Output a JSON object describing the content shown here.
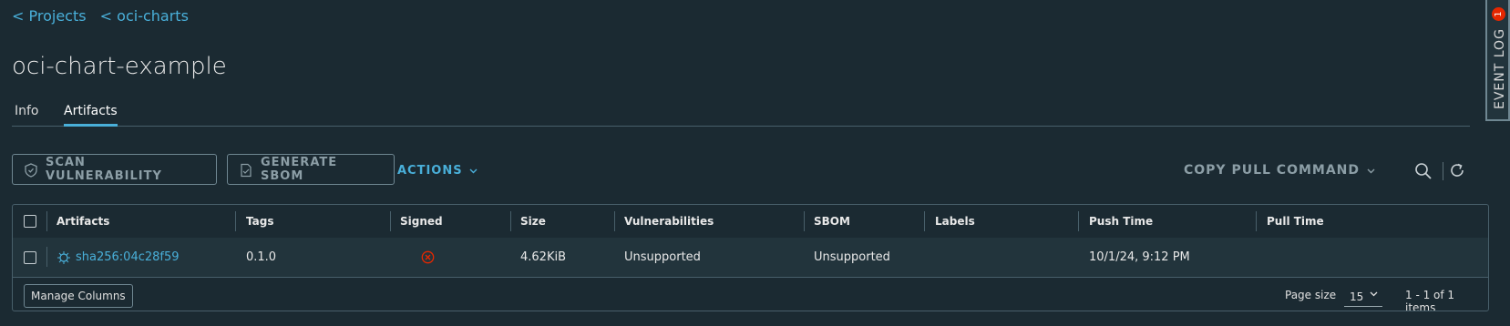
{
  "breadcrumb": {
    "projects": "< Projects",
    "repo": "< oci-charts"
  },
  "page_title": "oci-chart-example",
  "tabs": [
    {
      "label": "Info",
      "active": false
    },
    {
      "label": "Artifacts",
      "active": true
    }
  ],
  "toolbar": {
    "scan_label": "SCAN VULNERABILITY",
    "sbom_label": "GENERATE SBOM",
    "actions_label": "ACTIONS",
    "copy_pull_label": "COPY PULL COMMAND"
  },
  "table": {
    "columns": [
      "Artifacts",
      "Tags",
      "Signed",
      "Size",
      "Vulnerabilities",
      "SBOM",
      "Labels",
      "Push Time",
      "Pull Time"
    ],
    "rows": [
      {
        "artifact": "sha256:04c28f59",
        "artifact_icon": "helm-icon",
        "tags": "0.1.0",
        "signed_icon": "not-signed-icon",
        "size": "4.62KiB",
        "vulnerabilities": "Unsupported",
        "sbom": "Unsupported",
        "labels": "",
        "push_time": "10/1/24, 9:12 PM",
        "pull_time": ""
      }
    ]
  },
  "footer": {
    "manage_columns": "Manage Columns",
    "page_size_label": "Page size",
    "page_size": "15",
    "count": "1 - 1 of 1 items"
  },
  "event_log": {
    "label": "EVENT LOG",
    "badge": "1"
  },
  "colors": {
    "background": "#1b2a32",
    "accent": "#49afd9",
    "error": "#e62700"
  }
}
